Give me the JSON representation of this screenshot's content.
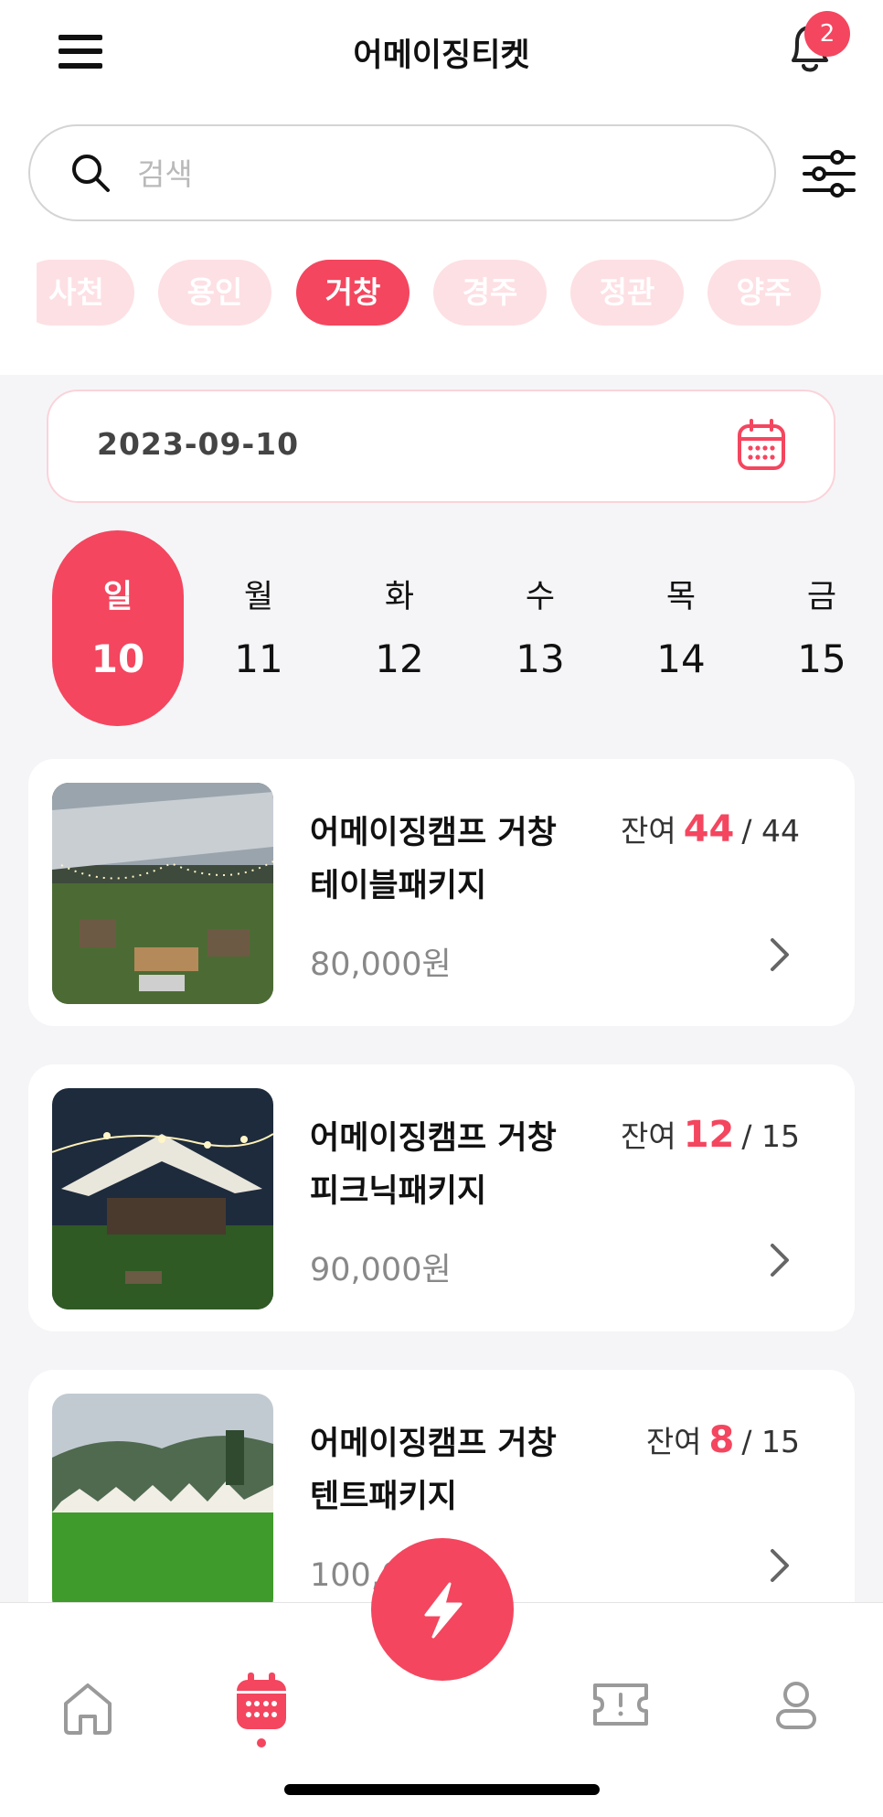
{
  "header": {
    "title": "어메이징티켓",
    "notification_count": "2"
  },
  "search": {
    "placeholder": "검색",
    "value": ""
  },
  "regions": [
    {
      "label": "사천",
      "active": false
    },
    {
      "label": "용인",
      "active": false
    },
    {
      "label": "거창",
      "active": true
    },
    {
      "label": "경주",
      "active": false
    },
    {
      "label": "정관",
      "active": false
    },
    {
      "label": "양주",
      "active": false
    }
  ],
  "date_field": {
    "value": "2023-09-10"
  },
  "week": [
    {
      "day": "일",
      "date": "10",
      "active": true
    },
    {
      "day": "월",
      "date": "11",
      "active": false
    },
    {
      "day": "화",
      "date": "12",
      "active": false
    },
    {
      "day": "수",
      "date": "13",
      "active": false
    },
    {
      "day": "목",
      "date": "14",
      "active": false
    },
    {
      "day": "금",
      "date": "15",
      "active": false
    }
  ],
  "products": [
    {
      "name_line1": "어메이징캠프 거창",
      "name_line2": "테이블패키지",
      "price": "80,000원",
      "remain_label": "잔여",
      "remain": "44",
      "total": "/ 44",
      "image": "tent-canopy-table-photo"
    },
    {
      "name_line1": "어메이징캠프 거창",
      "name_line2": "피크닉패키지",
      "price": "90,000원",
      "remain_label": "잔여",
      "remain": "12",
      "total": "/ 15",
      "image": "night-tent-lights-photo"
    },
    {
      "name_line1": "어메이징캠프 거창",
      "name_line2": "텐트패키지",
      "price": "100,000원",
      "remain_label": "잔여",
      "remain": "8",
      "total": "/ 15",
      "image": "field-tents-mountain-photo"
    }
  ],
  "nav": {
    "items": [
      {
        "icon": "home-icon",
        "active": false
      },
      {
        "icon": "calendar-icon",
        "active": true
      },
      {
        "icon": "ticket-icon",
        "active": false
      },
      {
        "icon": "profile-icon",
        "active": false
      }
    ],
    "fab_icon": "lightning-icon"
  },
  "colors": {
    "accent": "#f4465f",
    "chip_inactive": "#fde0e4"
  }
}
